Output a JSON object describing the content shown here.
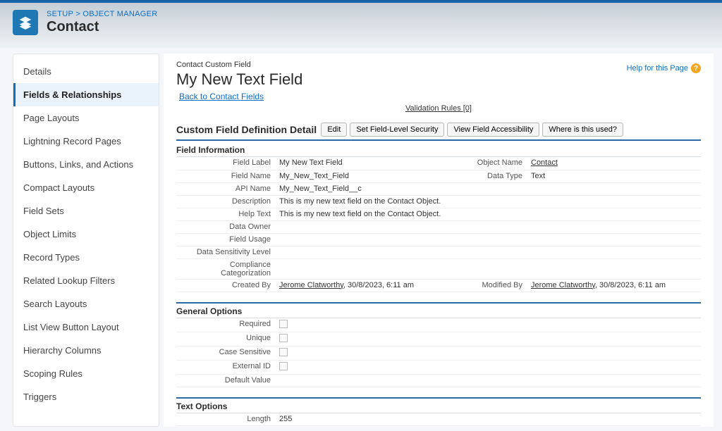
{
  "header": {
    "breadcrumb": "SETUP > OBJECT MANAGER",
    "title": "Contact"
  },
  "sidebar": {
    "items": [
      "Details",
      "Fields & Relationships",
      "Page Layouts",
      "Lightning Record Pages",
      "Buttons, Links, and Actions",
      "Compact Layouts",
      "Field Sets",
      "Object Limits",
      "Record Types",
      "Related Lookup Filters",
      "Search Layouts",
      "List View Button Layout",
      "Hierarchy Columns",
      "Scoping Rules",
      "Triggers"
    ],
    "active_index": 1
  },
  "help_link": "Help for this Page",
  "page": {
    "crumb": "Contact Custom Field",
    "title": "My New Text Field",
    "back": "Back to Contact Fields",
    "validation_rules": "Validation Rules [0]"
  },
  "section": {
    "title": "Custom Field Definition Detail",
    "buttons": [
      "Edit",
      "Set Field-Level Security",
      "View Field Accessibility",
      "Where is this used?"
    ]
  },
  "field_info": {
    "heading": "Field Information",
    "labels": {
      "field_label": "Field Label",
      "field_name": "Field Name",
      "api_name": "API Name",
      "description": "Description",
      "help_text": "Help Text",
      "data_owner": "Data Owner",
      "field_usage": "Field Usage",
      "data_sensitivity": "Data Sensitivity Level",
      "compliance": "Compliance Categorization",
      "created_by": "Created By",
      "object_name": "Object Name",
      "data_type": "Data Type",
      "modified_by": "Modified By"
    },
    "values": {
      "field_label": "My New Text Field",
      "field_name": "My_New_Text_Field",
      "api_name": "My_New_Text_Field__c",
      "description": "This is my new text field on the Contact Object.",
      "help_text": "This is my new text field on the Contact Object.",
      "data_owner": "",
      "field_usage": "",
      "data_sensitivity": "",
      "compliance": "",
      "created_by_name": "Jerome Clatworthy",
      "created_by_date": ", 30/8/2023, 6:11 am",
      "object_name": "Contact",
      "data_type": "Text",
      "modified_by_name": "Jerome Clatworthy",
      "modified_by_date": ", 30/8/2023, 6:11 am"
    }
  },
  "general_options": {
    "heading": "General Options",
    "labels": {
      "required": "Required",
      "unique": "Unique",
      "case_sensitive": "Case Sensitive",
      "external_id": "External ID",
      "default_value": "Default Value"
    }
  },
  "text_options": {
    "heading": "Text Options",
    "labels": {
      "length": "Length"
    },
    "values": {
      "length": "255"
    }
  }
}
